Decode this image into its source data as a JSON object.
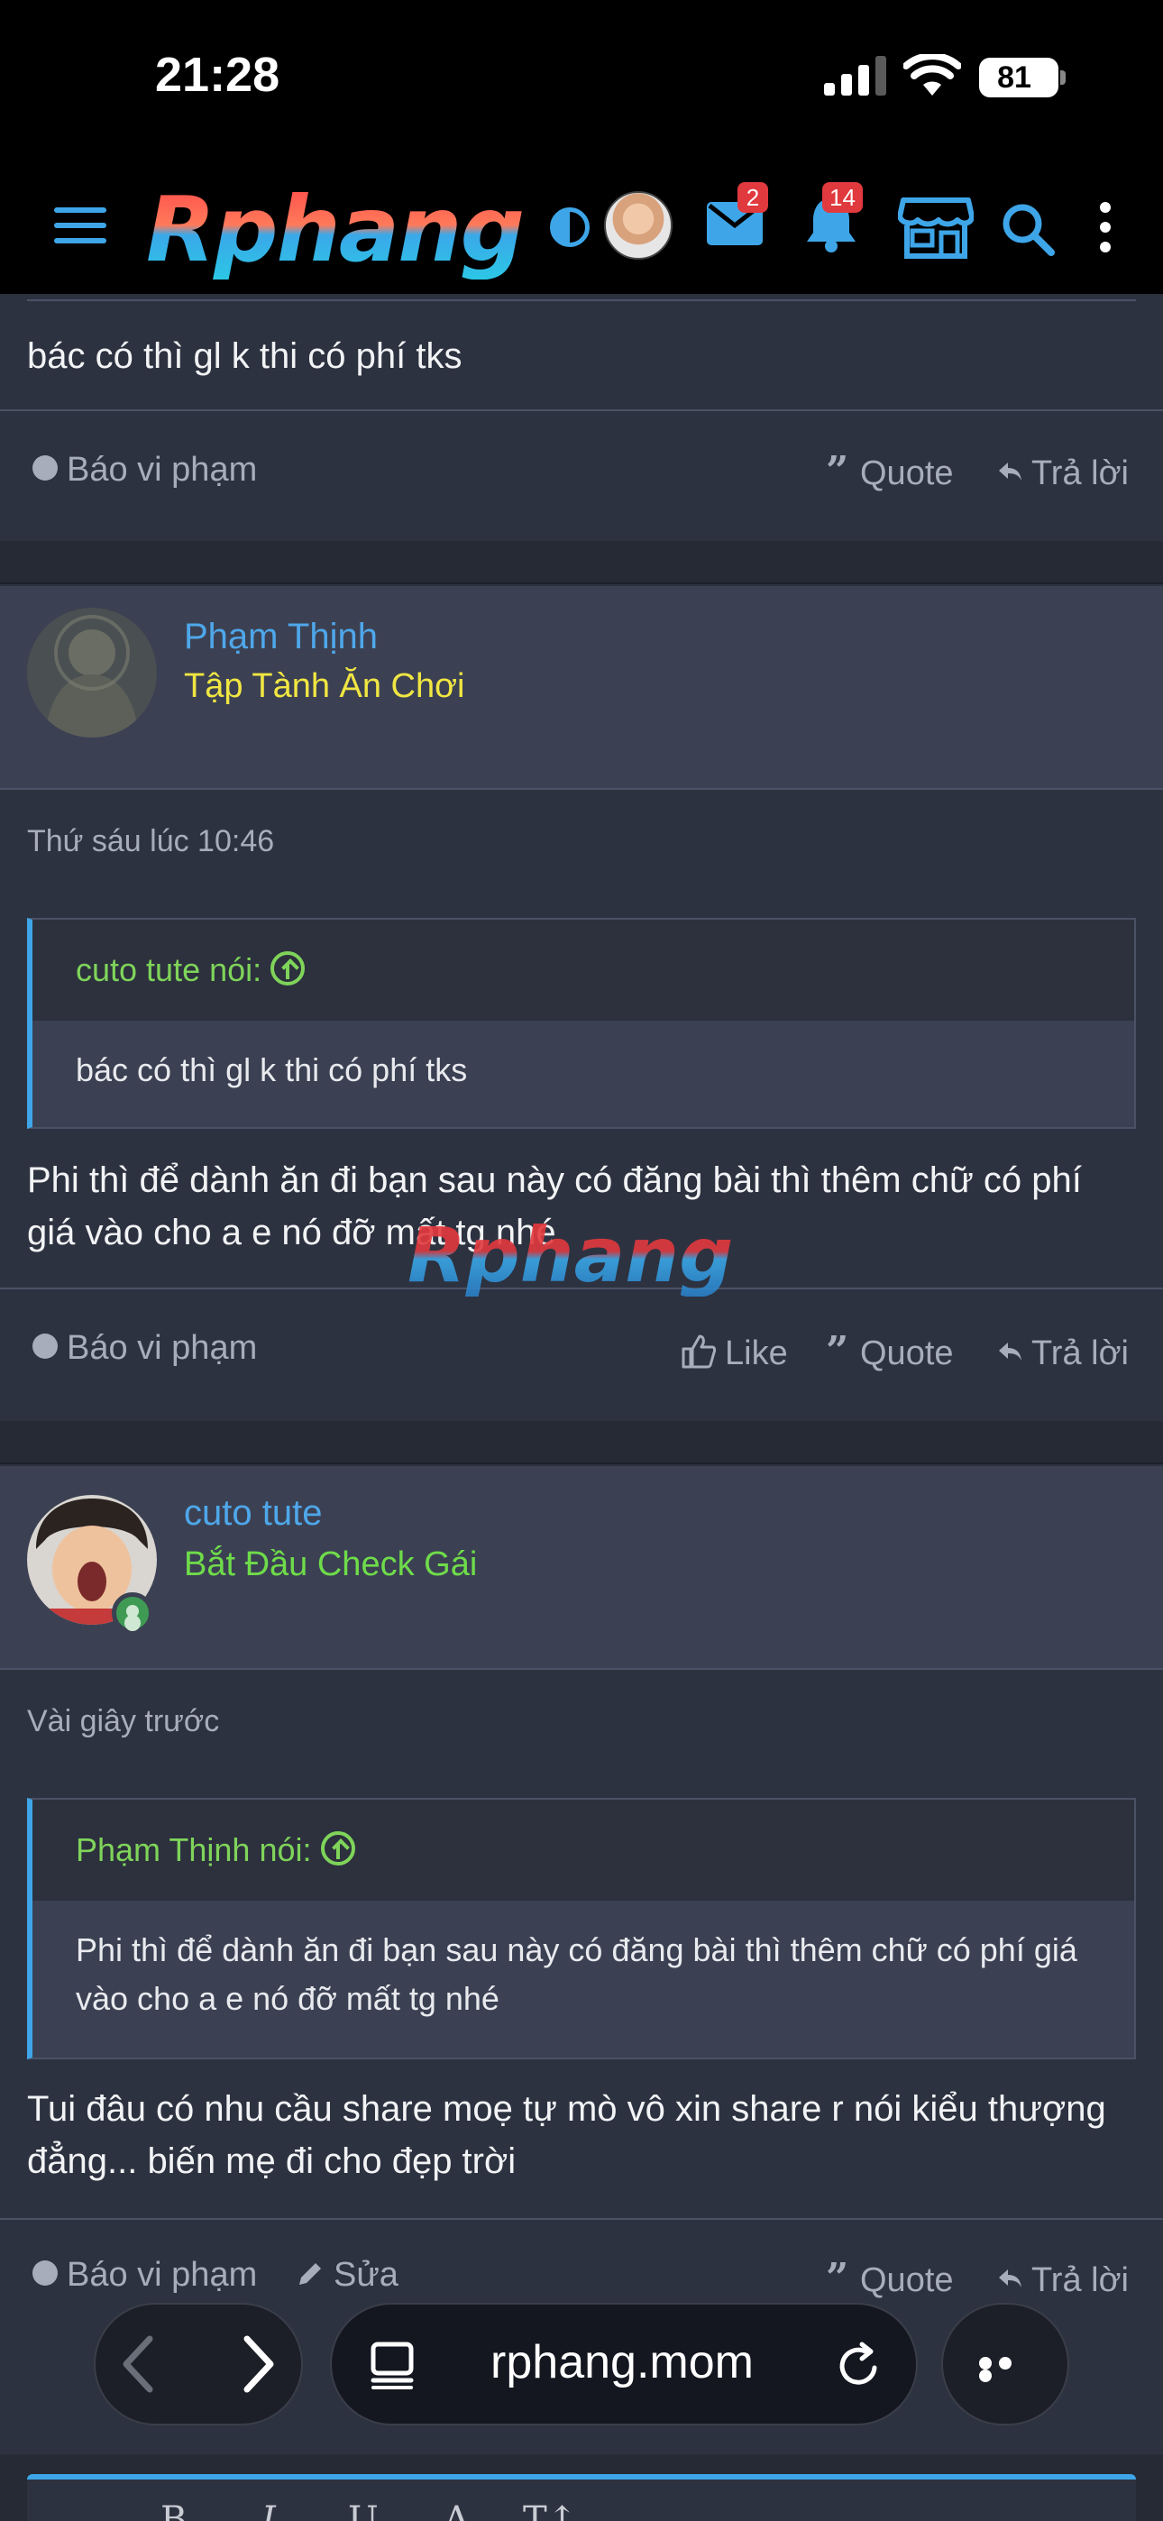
{
  "status_bar": {
    "time": "21:28",
    "battery": "81"
  },
  "header": {
    "logo": "Rphang",
    "mail_count": "2",
    "alert_count": "14"
  },
  "top_post": {
    "message": "bác có thì gl k thi có phí tks",
    "actions": {
      "report": "Báo vi phạm",
      "quote": "Quote",
      "reply": "Trả lời"
    }
  },
  "posts": [
    {
      "username": "Phạm Thịnh",
      "user_title": "Tập Tành Ăn Chơi",
      "user_title_color": "#f1e642",
      "date": "Thứ sáu lúc 10:46",
      "quote_author": "cuto tute nói:",
      "quote_text": "bác có thì gl k thi có phí tks",
      "message": "Phi thì để dành ăn đi bạn sau này có đăng bài thì thêm chữ có phí giá vào cho a e nó đỡ mất tg nhé",
      "actions": {
        "report": "Báo vi phạm",
        "like": "Like",
        "quote": "Quote",
        "reply": "Trả lời"
      }
    },
    {
      "username": "cuto tute",
      "user_title": "Bắt Đầu Check Gái",
      "user_title_color": "#6fdc4a",
      "date": "Vài giây trước",
      "quote_author": "Phạm Thịnh nói:",
      "quote_text": "Phi thì để dành ăn đi bạn sau này có đăng bài thì thêm chữ có phí giá vào cho a e nó đỡ mất tg nhé",
      "message": "Tui đâu có nhu cầu share moẹ tự mò vô xin share r nói kiểu thượng đẳng... biến mẹ đi cho đẹp trời",
      "actions": {
        "report": "Báo vi phạm",
        "edit": "Sửa",
        "quote": "Quote",
        "reply": "Trả lời"
      }
    }
  ],
  "watermark": "Rphang",
  "browser": {
    "url": "rphang.mom"
  },
  "editor": {
    "buttons": [
      "B",
      "I",
      "U",
      "A",
      "T↕"
    ]
  },
  "colors": {
    "accent": "#3ea6e8",
    "username": "#4fa7ea",
    "quote_head": "#7fd45a",
    "badge": "#e0393e"
  }
}
